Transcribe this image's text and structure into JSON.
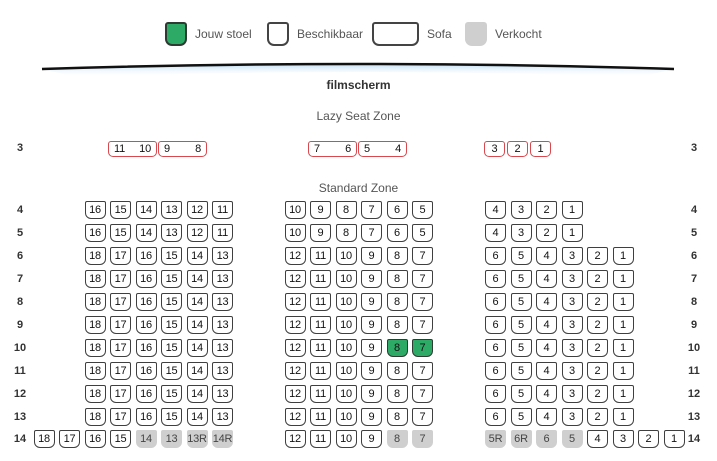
{
  "legend": [
    {
      "label": "Jouw stoel",
      "status": "mine"
    },
    {
      "label": "Beschikbaar",
      "status": "available"
    },
    {
      "label": "Sofa",
      "status": "sofa"
    },
    {
      "label": "Verkocht",
      "status": "sold"
    }
  ],
  "screen_label": "filmscherm",
  "zones": {
    "lazy": "Lazy Seat Zone",
    "standard": "Standard Zone"
  },
  "colors": {
    "mine": "#2eaa67",
    "available": "#ffffff",
    "sold": "#cfcfcf",
    "sofa_border": "#d9484d",
    "seat_border": "#3f3f3f"
  },
  "sofa_row": {
    "row": "3",
    "blocks": [
      [
        {
          "seats": [
            "11",
            "10"
          ]
        },
        {
          "seats": [
            "9",
            "8"
          ]
        }
      ],
      [
        {
          "seats": [
            "7",
            "6"
          ]
        },
        {
          "seats": [
            "5",
            "4"
          ]
        }
      ],
      [
        {
          "seats": [
            "3"
          ]
        },
        {
          "seats": [
            "2"
          ]
        },
        {
          "seats": [
            "1"
          ]
        }
      ]
    ]
  },
  "rows": [
    {
      "row": "4",
      "blocks": [
        [
          "16",
          "15",
          "14",
          "13",
          "12",
          "11"
        ],
        [
          "10",
          "9",
          "8",
          "7",
          "6",
          "5"
        ],
        [
          "4",
          "3",
          "2",
          "1"
        ]
      ]
    },
    {
      "row": "5",
      "blocks": [
        [
          "16",
          "15",
          "14",
          "13",
          "12",
          "11"
        ],
        [
          "10",
          "9",
          "8",
          "7",
          "6",
          "5"
        ],
        [
          "4",
          "3",
          "2",
          "1"
        ]
      ]
    },
    {
      "row": "6",
      "blocks": [
        [
          "18",
          "17",
          "16",
          "15",
          "14",
          "13"
        ],
        [
          "12",
          "11",
          "10",
          "9",
          "8",
          "7"
        ],
        [
          "6",
          "5",
          "4",
          "3",
          "2",
          "1"
        ]
      ]
    },
    {
      "row": "7",
      "blocks": [
        [
          "18",
          "17",
          "16",
          "15",
          "14",
          "13"
        ],
        [
          "12",
          "11",
          "10",
          "9",
          "8",
          "7"
        ],
        [
          "6",
          "5",
          "4",
          "3",
          "2",
          "1"
        ]
      ]
    },
    {
      "row": "8",
      "blocks": [
        [
          "18",
          "17",
          "16",
          "15",
          "14",
          "13"
        ],
        [
          "12",
          "11",
          "10",
          "9",
          "8",
          "7"
        ],
        [
          "6",
          "5",
          "4",
          "3",
          "2",
          "1"
        ]
      ]
    },
    {
      "row": "9",
      "blocks": [
        [
          "18",
          "17",
          "16",
          "15",
          "14",
          "13"
        ],
        [
          "12",
          "11",
          "10",
          "9",
          "8",
          "7"
        ],
        [
          "6",
          "5",
          "4",
          "3",
          "2",
          "1"
        ]
      ]
    },
    {
      "row": "10",
      "blocks": [
        [
          "18",
          "17",
          "16",
          "15",
          "14",
          "13"
        ],
        [
          "12",
          "11",
          "10",
          "9",
          "8*",
          "7*"
        ],
        [
          "6",
          "5",
          "4",
          "3",
          "2",
          "1"
        ]
      ]
    },
    {
      "row": "11",
      "blocks": [
        [
          "18",
          "17",
          "16",
          "15",
          "14",
          "13"
        ],
        [
          "12",
          "11",
          "10",
          "9",
          "8",
          "7"
        ],
        [
          "6",
          "5",
          "4",
          "3",
          "2",
          "1"
        ]
      ]
    },
    {
      "row": "12",
      "blocks": [
        [
          "18",
          "17",
          "16",
          "15",
          "14",
          "13"
        ],
        [
          "12",
          "11",
          "10",
          "9",
          "8",
          "7"
        ],
        [
          "6",
          "5",
          "4",
          "3",
          "2",
          "1"
        ]
      ]
    },
    {
      "row": "13",
      "blocks": [
        [
          "18",
          "17",
          "16",
          "15",
          "14",
          "13"
        ],
        [
          "12",
          "11",
          "10",
          "9",
          "8",
          "7"
        ],
        [
          "6",
          "5",
          "4",
          "3",
          "2",
          "1"
        ]
      ]
    },
    {
      "row": "14",
      "blocks": [
        [
          "18",
          "17",
          "16",
          "15",
          "14#",
          "13#",
          "13R#",
          "14R#"
        ],
        [
          "12",
          "11",
          "10",
          "9",
          "8#",
          "7#"
        ],
        [
          "5R#",
          "6R#",
          "6#",
          "5#",
          "4",
          "3",
          "2",
          "1"
        ]
      ]
    }
  ]
}
